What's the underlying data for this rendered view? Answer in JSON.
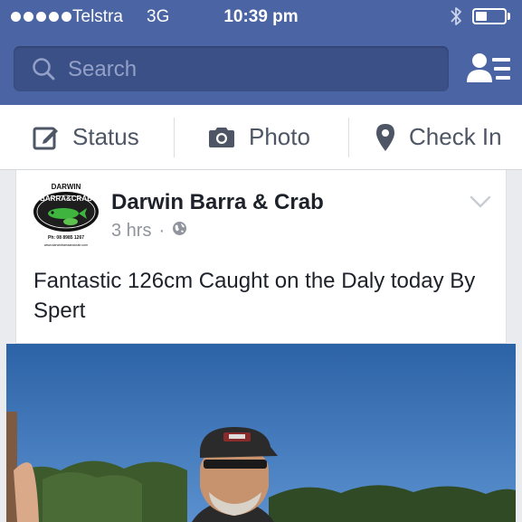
{
  "status_bar": {
    "carrier": "Telstra",
    "network": "3G",
    "time": "10:39 pm",
    "signal_bars": 5,
    "battery_level": 0.4
  },
  "search": {
    "placeholder": "Search"
  },
  "composer": {
    "status_label": "Status",
    "photo_label": "Photo",
    "checkin_label": "Check In"
  },
  "post": {
    "page_name": "Darwin Barra & Crab",
    "time_ago": "3 hrs",
    "separator": "·",
    "text": "Fantastic 126cm Caught on the Daly today By Spert",
    "logo": {
      "arc_text": "DARWIN",
      "brand": "BARRA&CRAB",
      "phone": "Ph: 08 8985 1267",
      "web": "www.darwinbarraandcrab.com"
    }
  },
  "colors": {
    "header_blue": "#4b64a3",
    "search_bg": "#3b5087",
    "text_dark": "#1d2129",
    "text_grey": "#90949c"
  },
  "icons": [
    "search-icon",
    "contacts-icon",
    "edit-icon",
    "camera-icon",
    "location-pin-icon",
    "globe-icon",
    "chevron-down-icon",
    "bluetooth-icon",
    "battery-icon"
  ]
}
